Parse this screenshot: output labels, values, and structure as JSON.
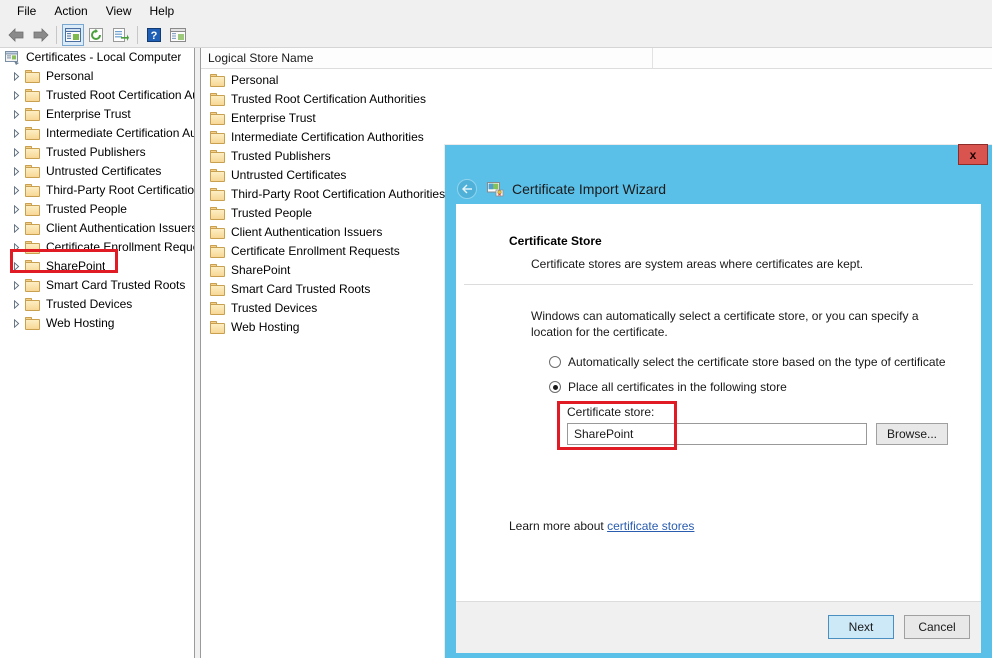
{
  "window": {
    "menu": [
      "File",
      "Action",
      "View",
      "Help"
    ],
    "toolbar": [
      {
        "name": "back-icon",
        "glyph": "←"
      },
      {
        "name": "forward-icon",
        "glyph": "→"
      },
      {
        "name": "show-hide-console-tree-icon",
        "glyph": "▤"
      },
      {
        "name": "refresh-icon",
        "glyph": "↻"
      },
      {
        "name": "export-list-icon",
        "glyph": "➡"
      },
      {
        "name": "help-icon",
        "glyph": "?"
      },
      {
        "name": "properties-icon",
        "glyph": "▤"
      }
    ]
  },
  "tree": {
    "root_label": "Certificates - Local Computer",
    "items": [
      {
        "label": "Personal"
      },
      {
        "label": "Trusted Root Certification Au"
      },
      {
        "label": "Enterprise Trust"
      },
      {
        "label": "Intermediate Certification Au"
      },
      {
        "label": "Trusted Publishers"
      },
      {
        "label": "Untrusted Certificates"
      },
      {
        "label": "Third-Party Root Certification"
      },
      {
        "label": "Trusted People"
      },
      {
        "label": "Client Authentication Issuers"
      },
      {
        "label": "Certificate Enrollment Reques"
      },
      {
        "label": "SharePoint"
      },
      {
        "label": "Smart Card Trusted Roots"
      },
      {
        "label": "Trusted Devices"
      },
      {
        "label": "Web Hosting"
      }
    ]
  },
  "list": {
    "columns": [
      "Logical Store Name",
      ""
    ],
    "rows": [
      {
        "label": "Personal"
      },
      {
        "label": "Trusted Root Certification Authorities"
      },
      {
        "label": "Enterprise Trust"
      },
      {
        "label": "Intermediate Certification Authorities"
      },
      {
        "label": "Trusted Publishers"
      },
      {
        "label": "Untrusted Certificates"
      },
      {
        "label": "Third-Party Root Certification Authorities"
      },
      {
        "label": "Trusted People"
      },
      {
        "label": "Client Authentication Issuers"
      },
      {
        "label": "Certificate Enrollment Requests"
      },
      {
        "label": "SharePoint"
      },
      {
        "label": "Smart Card Trusted Roots"
      },
      {
        "label": "Trusted Devices"
      },
      {
        "label": "Web Hosting"
      }
    ]
  },
  "wizard": {
    "title": "Certificate Import Wizard",
    "close_label": "x",
    "back_glyph": "←",
    "heading": "Certificate Store",
    "subheading": "Certificate stores are system areas where certificates are kept.",
    "intro": "Windows can automatically select a certificate store, or you can specify a location for the certificate.",
    "options": [
      {
        "label": "Automatically select the certificate store based on the type of certificate",
        "checked": false
      },
      {
        "label": "Place all certificates in the following store",
        "checked": true
      }
    ],
    "store_caption": "Certificate store:",
    "store_value": "SharePoint",
    "store_placeholder": "",
    "browse_label": "Browse...",
    "learn_prefix": "Learn more about ",
    "learn_link": "certificate stores",
    "next_label": "Next",
    "cancel_label": "Cancel"
  },
  "highlights": {
    "accent_red": "#e01b24",
    "wizard_blue": "#5bc0e8"
  }
}
